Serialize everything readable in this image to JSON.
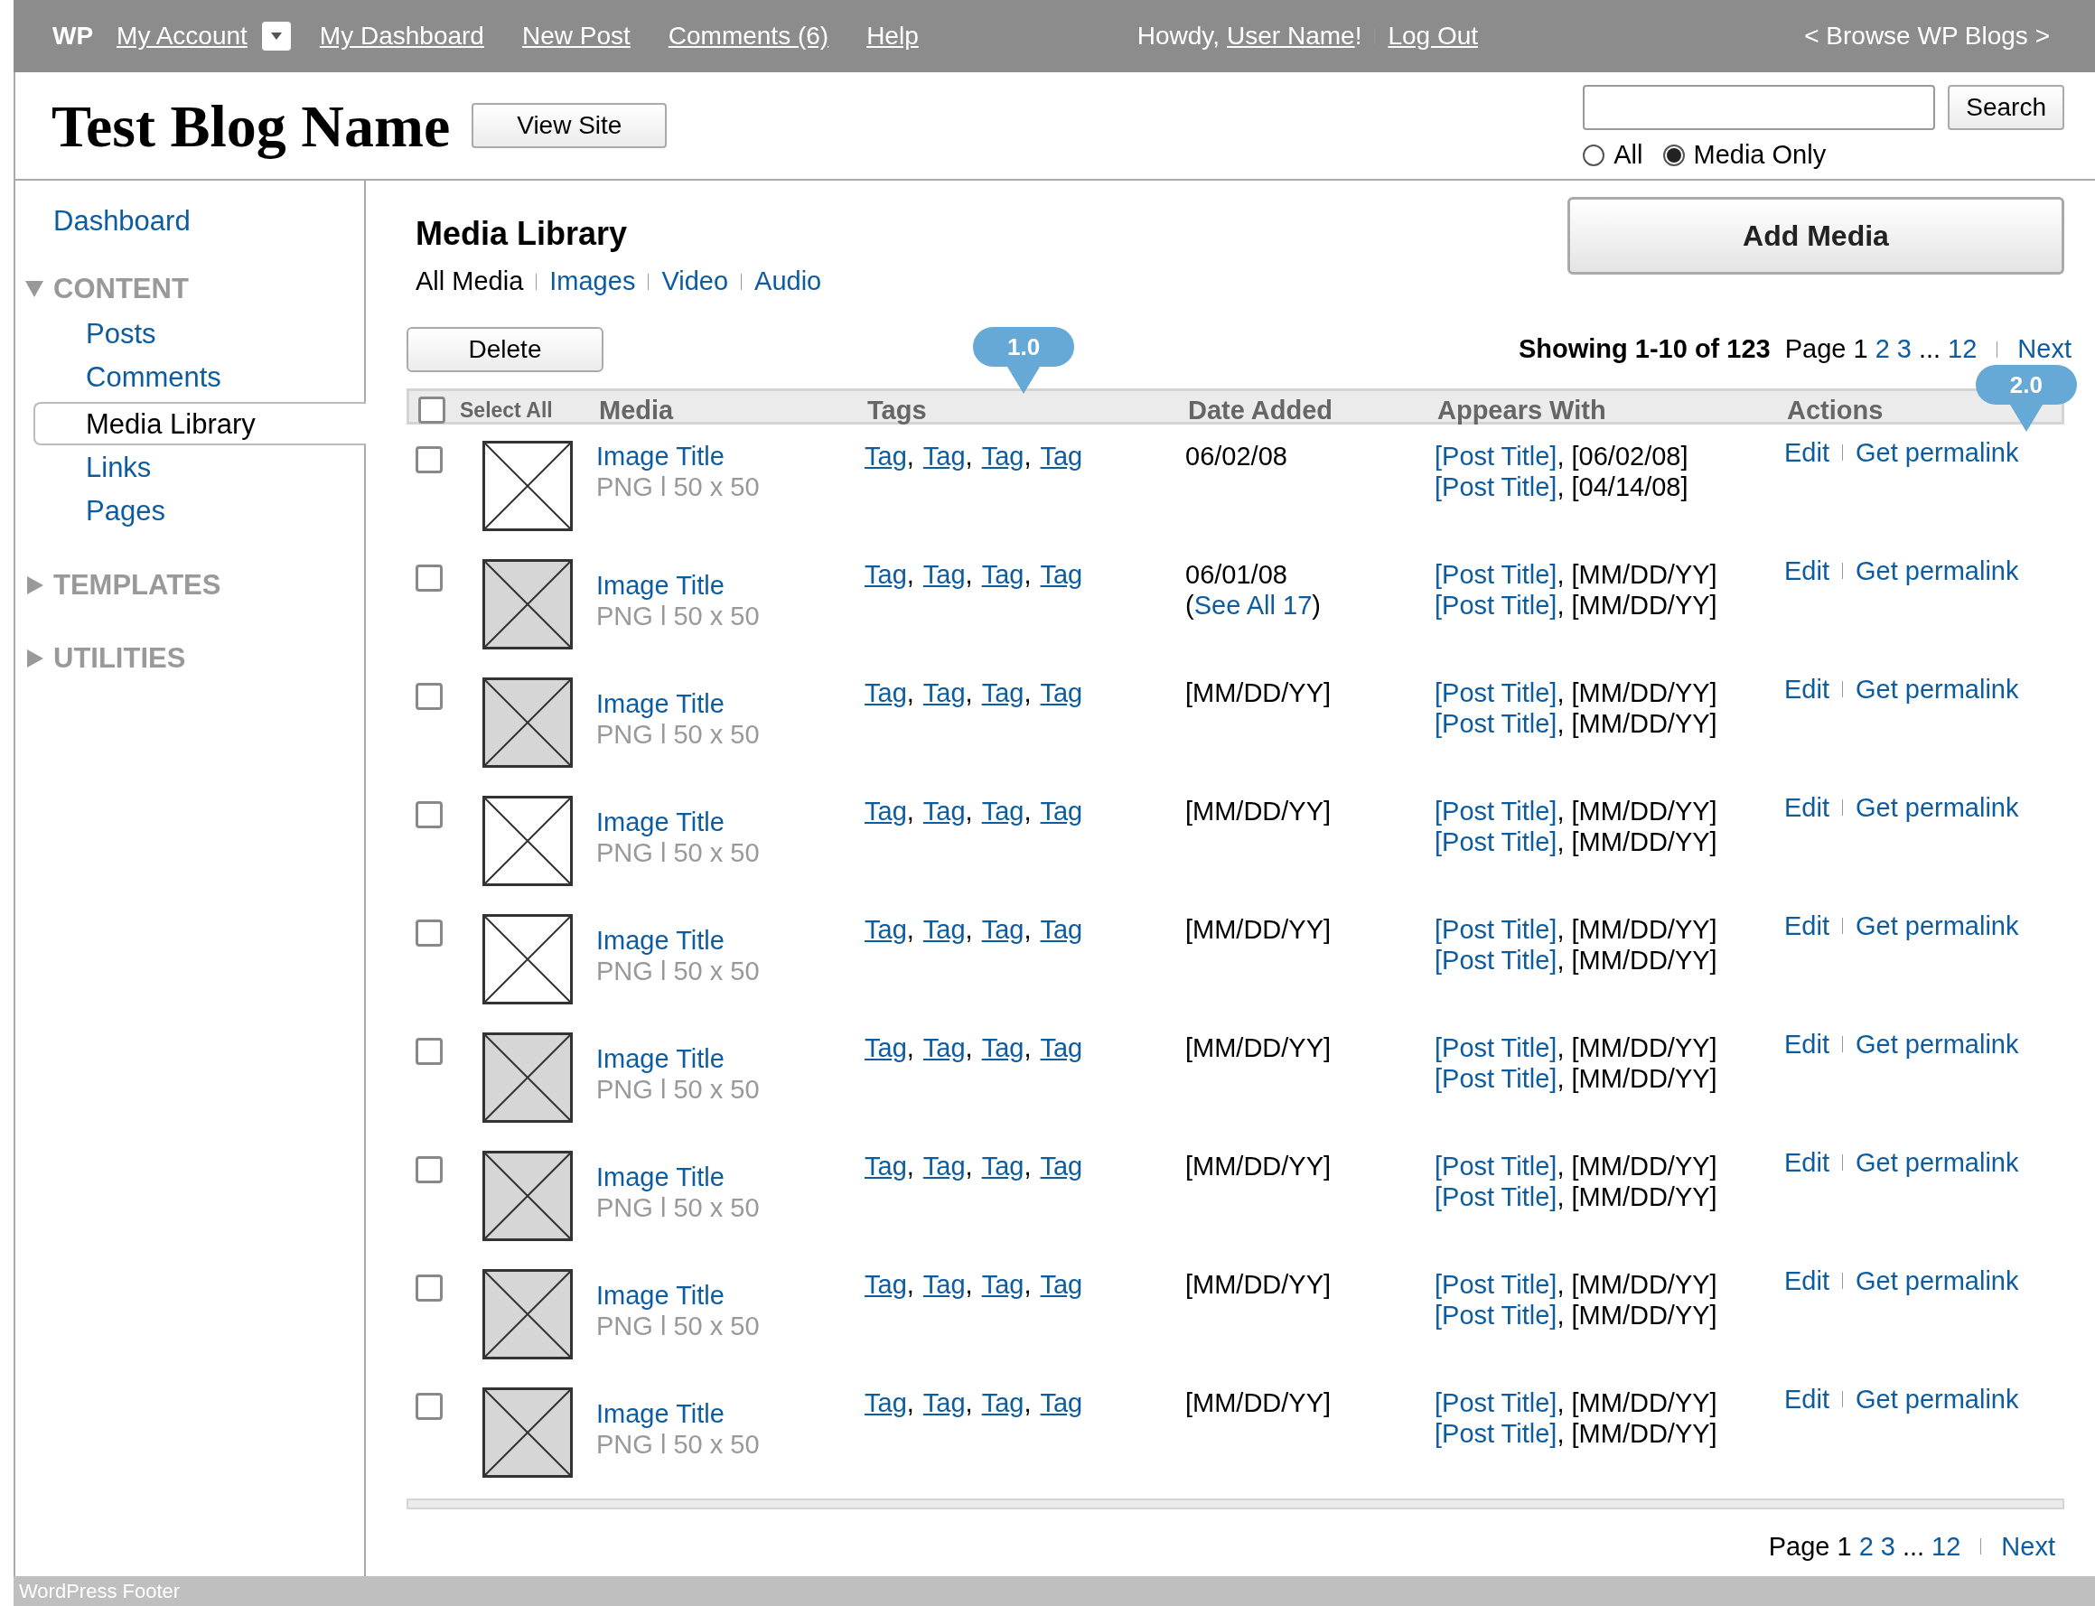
{
  "top_bar": {
    "logo": "WP",
    "links": [
      {
        "label": "My Account",
        "dropdown": true
      },
      {
        "label": "My Dashboard",
        "dropdown": false
      },
      {
        "label": "New Post",
        "dropdown": false
      },
      {
        "label": "Comments (6)",
        "dropdown": false
      },
      {
        "label": "Help",
        "dropdown": false
      }
    ],
    "greeting": "Howdy,",
    "user": "User Name",
    "greeting_end": "!",
    "logout": "Log Out",
    "browse": "< Browse WP Blogs >"
  },
  "header": {
    "blog_title": "Test Blog Name",
    "view_site": "View Site",
    "search_button": "Search",
    "scope": [
      {
        "label": "All",
        "selected": false
      },
      {
        "label": "Media Only",
        "selected": true
      }
    ]
  },
  "sidebar": {
    "items": [
      {
        "kind": "link",
        "label": "Dashboard"
      },
      {
        "kind": "section",
        "label": "CONTENT",
        "expanded": true,
        "children": [
          {
            "label": "Posts",
            "selected": false
          },
          {
            "label": "Comments",
            "selected": false
          },
          {
            "label": "Media Library",
            "selected": true
          },
          {
            "label": "Links",
            "selected": false
          },
          {
            "label": "Pages",
            "selected": false
          }
        ]
      },
      {
        "kind": "section",
        "label": "TEMPLATES",
        "expanded": false
      },
      {
        "kind": "section",
        "label": "UTILITIES",
        "expanded": false
      }
    ]
  },
  "page": {
    "title": "Media Library",
    "filters": [
      {
        "label": "All Media",
        "selected": true
      },
      {
        "label": "Images",
        "selected": false
      },
      {
        "label": "Video",
        "selected": false
      },
      {
        "label": "Audio",
        "selected": false
      }
    ],
    "add_button": "Add Media",
    "delete_button": "Delete",
    "showing": "Showing 1-10 of 123"
  },
  "pagination_top": {
    "label": "Page 1",
    "pages": [
      "2",
      "3"
    ],
    "ellipsis": "...",
    "last": "12",
    "next": "Next"
  },
  "annotations": [
    "1.0",
    "2.0"
  ],
  "table": {
    "select_all": "Select All",
    "select_all_checked": false,
    "columns": [
      "Media",
      "Tags",
      "Date Added",
      "Appears With",
      "Actions"
    ],
    "tag_separator": ",",
    "rows": [
      {
        "checked": false,
        "kind": "plain",
        "title": "Image Title",
        "meta": "PNG l 50 x 50",
        "tags": [
          "Tag",
          "Tag",
          "Tag",
          "Tag"
        ],
        "date": "06/02/08",
        "appears": [
          {
            "post": "[Post Title]",
            "rest": ", [06/02/08]"
          },
          {
            "post": "[Post Title]",
            "rest": ", [04/14/08]"
          }
        ],
        "actions": [
          "Edit",
          "Get permalink"
        ]
      },
      {
        "checked": false,
        "kind": "shaded",
        "title": "Image Title",
        "meta": "PNG l 50 x 50",
        "tags": [
          "Tag",
          "Tag",
          "Tag",
          "Tag"
        ],
        "date": "06/01/08",
        "see_all": {
          "open": "(",
          "link": "See All 17",
          "close": ")"
        },
        "appears": [
          {
            "post": "[Post Title]",
            "rest": ", [MM/DD/YY]"
          },
          {
            "post": "[Post Title]",
            "rest": ", [MM/DD/YY]"
          }
        ],
        "actions": [
          "Edit",
          "Get permalink"
        ]
      },
      {
        "checked": false,
        "kind": "shaded",
        "title": "Image Title",
        "meta": "PNG l 50 x 50",
        "tags": [
          "Tag",
          "Tag",
          "Tag",
          "Tag"
        ],
        "date": "[MM/DD/YY]",
        "appears": [
          {
            "post": "[Post Title]",
            "rest": ", [MM/DD/YY]"
          },
          {
            "post": "[Post Title]",
            "rest": ", [MM/DD/YY]"
          }
        ],
        "actions": [
          "Edit",
          "Get permalink"
        ]
      },
      {
        "checked": false,
        "kind": "plain",
        "title": "Image Title",
        "meta": "PNG l 50 x 50",
        "tags": [
          "Tag",
          "Tag",
          "Tag",
          "Tag"
        ],
        "date": "[MM/DD/YY]",
        "appears": [
          {
            "post": "[Post Title]",
            "rest": ", [MM/DD/YY]"
          },
          {
            "post": "[Post Title]",
            "rest": ", [MM/DD/YY]"
          }
        ],
        "actions": [
          "Edit",
          "Get permalink"
        ]
      },
      {
        "checked": false,
        "kind": "plain",
        "title": "Image Title",
        "meta": "PNG l 50 x 50",
        "tags": [
          "Tag",
          "Tag",
          "Tag",
          "Tag"
        ],
        "date": "[MM/DD/YY]",
        "appears": [
          {
            "post": "[Post Title]",
            "rest": ", [MM/DD/YY]"
          },
          {
            "post": "[Post Title]",
            "rest": ", [MM/DD/YY]"
          }
        ],
        "actions": [
          "Edit",
          "Get permalink"
        ]
      },
      {
        "checked": false,
        "kind": "shaded",
        "title": "Image Title",
        "meta": "PNG l 50 x 50",
        "tags": [
          "Tag",
          "Tag",
          "Tag",
          "Tag"
        ],
        "date": "[MM/DD/YY]",
        "appears": [
          {
            "post": "[Post Title]",
            "rest": ", [MM/DD/YY]"
          },
          {
            "post": "[Post Title]",
            "rest": ", [MM/DD/YY]"
          }
        ],
        "actions": [
          "Edit",
          "Get permalink"
        ]
      },
      {
        "checked": false,
        "kind": "shaded",
        "title": "Image Title",
        "meta": "PNG l 50 x 50",
        "tags": [
          "Tag",
          "Tag",
          "Tag",
          "Tag"
        ],
        "date": "[MM/DD/YY]",
        "appears": [
          {
            "post": "[Post Title]",
            "rest": ", [MM/DD/YY]"
          },
          {
            "post": "[Post Title]",
            "rest": ", [MM/DD/YY]"
          }
        ],
        "actions": [
          "Edit",
          "Get permalink"
        ]
      },
      {
        "checked": false,
        "kind": "shaded",
        "title": "Image Title",
        "meta": "PNG l 50 x 50",
        "tags": [
          "Tag",
          "Tag",
          "Tag",
          "Tag"
        ],
        "date": "[MM/DD/YY]",
        "appears": [
          {
            "post": "[Post Title]",
            "rest": ", [MM/DD/YY]"
          },
          {
            "post": "[Post Title]",
            "rest": ", [MM/DD/YY]"
          }
        ],
        "actions": [
          "Edit",
          "Get permalink"
        ]
      },
      {
        "checked": false,
        "kind": "shaded",
        "title": "Image Title",
        "meta": "PNG l 50 x 50",
        "tags": [
          "Tag",
          "Tag",
          "Tag",
          "Tag"
        ],
        "date": "[MM/DD/YY]",
        "appears": [
          {
            "post": "[Post Title]",
            "rest": ", [MM/DD/YY]"
          },
          {
            "post": "[Post Title]",
            "rest": ", [MM/DD/YY]"
          }
        ],
        "actions": [
          "Edit",
          "Get permalink"
        ]
      }
    ]
  },
  "pagination_bottom": {
    "label": "Page 1",
    "pages": [
      "2",
      "3"
    ],
    "ellipsis": "...",
    "last": "12",
    "next": "Next"
  },
  "footer": "WordPress Footer"
}
